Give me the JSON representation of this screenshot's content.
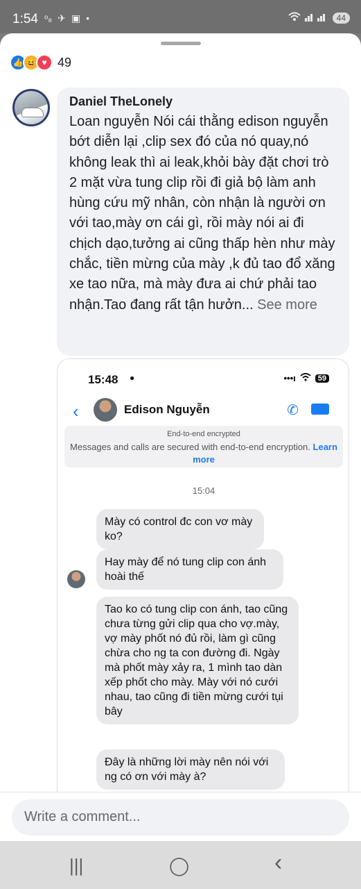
{
  "status_bar": {
    "time": "1:54",
    "left_icons": [
      "ᵒ₈",
      "✈",
      "▣",
      "•"
    ],
    "battery": "44"
  },
  "reactions": {
    "types": [
      "like",
      "haha",
      "love"
    ],
    "count": "49"
  },
  "comment": {
    "author": "Daniel TheLonely",
    "text": "Loan nguyễn Nói cái thằng edison nguyễn  bớt diễn lại ,clip sex đó của nó quay,nó không leak thì ai leak,khỏi bày đặt chơi trò 2 mặt vừa tung clip rồi đi giả bộ làm anh hùng cứu mỹ nhân, còn nhận là người ơn với tao,mày ơn cái gì, rồi mày nói ai đi chịch dạo,tưởng ai cũng thấp hèn như mày chắc, tiền mừng của  mày ,k đủ tao đổ xăng  xe tao nữa, mà mày đưa ai chứ phải  tao nhận.Tao đang rất tận hưởn...",
    "see_more": "See more"
  },
  "screenshot": {
    "time": "15:48",
    "battery": "59",
    "contact_name": "Edison Nguyễn",
    "enc_title": "End-to-end encrypted",
    "enc_text": "Messages and calls are secured with end-to-end encryption.",
    "enc_link": "Learn more",
    "timestamp": "15:04",
    "messages": [
      "Mày có control đc con vơ mày ko?",
      "Hay mày để nó tung clip con ánh hoài thế",
      "Tao ko có tung clip con ánh, tao cũng chưa từng gửi clip qua cho vợ.mày, vợ mày phốt nó đủ rồi, làm gì cũng chừa cho ng ta con đường đi. Ngày mà phốt mày xảy ra, 1 mình tao dàn xếp phốt cho mày. Mày với nó cưới nhau, tao cũng đi tiền mừng cưới tụi bây",
      "Đây là những lời mày nên nói với ng có ơn với mày à?"
    ]
  },
  "input": {
    "placeholder": "Write a comment..."
  },
  "nav": {
    "recents": "|||",
    "home": "◯",
    "back": "‹"
  }
}
